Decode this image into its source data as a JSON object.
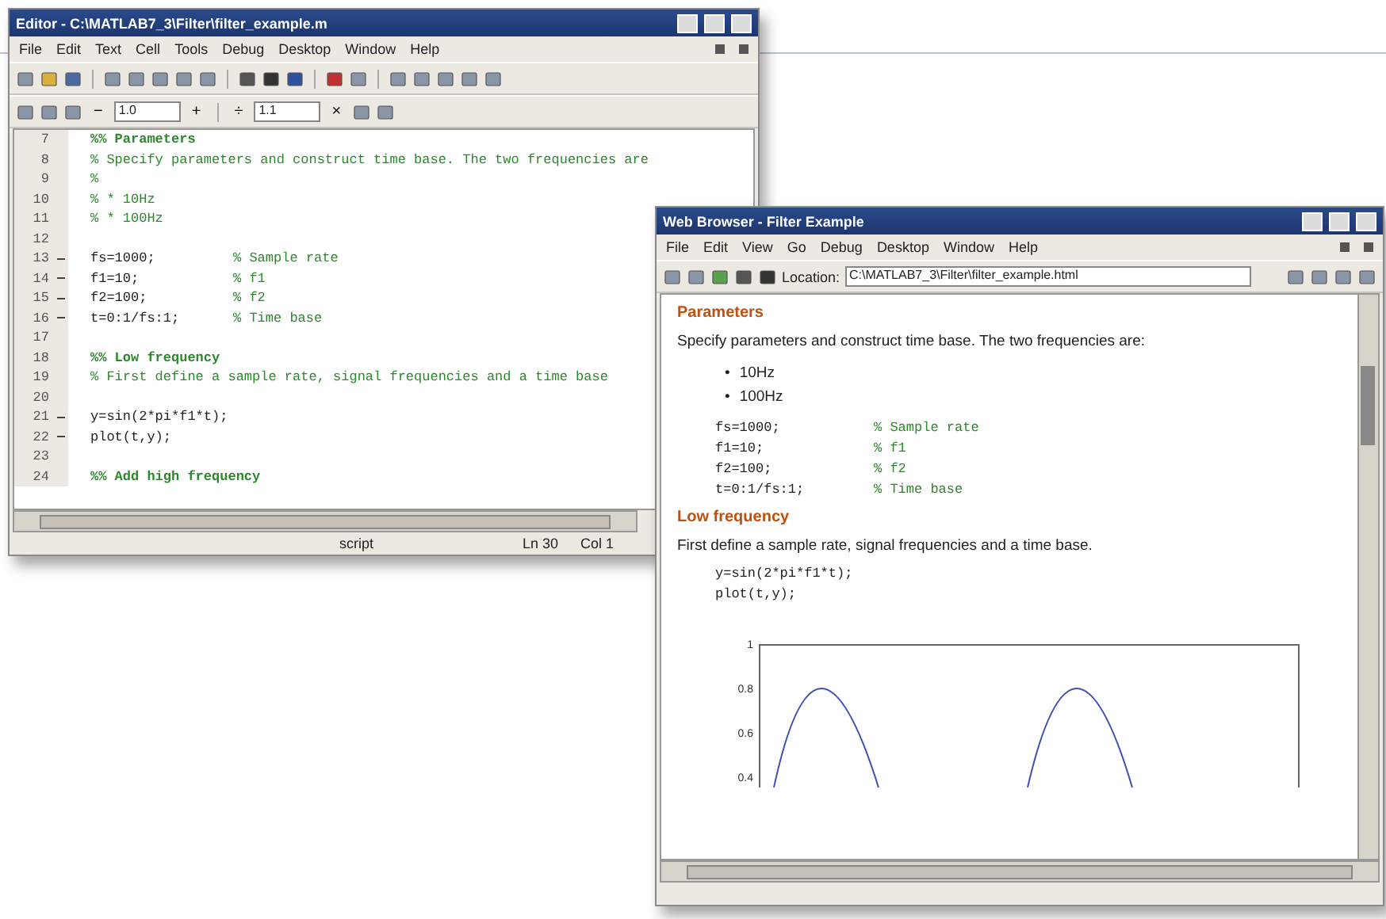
{
  "editor": {
    "title": "Editor - C:\\MATLAB7_3\\Filter\\filter_example.m",
    "menu": [
      "File",
      "Edit",
      "Text",
      "Cell",
      "Tools",
      "Debug",
      "Desktop",
      "Window",
      "Help"
    ],
    "cell_toolbar": {
      "minus": "−",
      "first_value": "1.0",
      "plus": "+",
      "divide": "÷",
      "second_value": "1.1",
      "times": "×"
    },
    "lines": [
      {
        "number": "7",
        "executable": false,
        "comment": "%% Parameters",
        "kind": "cell_title"
      },
      {
        "number": "8",
        "executable": false,
        "comment": "% Specify parameters and construct time base. The two frequencies are",
        "kind": "comment"
      },
      {
        "number": "9",
        "executable": false,
        "comment": "%",
        "kind": "comment"
      },
      {
        "number": "10",
        "executable": false,
        "comment": "% * 10Hz",
        "kind": "comment"
      },
      {
        "number": "11",
        "executable": false,
        "comment": "% * 100Hz",
        "kind": "comment"
      },
      {
        "number": "12",
        "executable": false,
        "kind": "blank"
      },
      {
        "number": "13",
        "executable": true,
        "code": "fs=1000;",
        "comment": "% Sample rate",
        "kind": "code"
      },
      {
        "number": "14",
        "executable": true,
        "code": "f1=10;",
        "comment": "% f1",
        "kind": "code"
      },
      {
        "number": "15",
        "executable": true,
        "code": "f2=100;",
        "comment": "% f2",
        "kind": "code"
      },
      {
        "number": "16",
        "executable": true,
        "code": "t=0:1/fs:1;",
        "comment": "% Time base",
        "kind": "code"
      },
      {
        "number": "17",
        "executable": false,
        "kind": "blank"
      },
      {
        "number": "18",
        "executable": false,
        "comment": "%% Low frequency",
        "kind": "cell_title"
      },
      {
        "number": "19",
        "executable": false,
        "comment": "% First define a sample rate, signal frequencies and a time base",
        "kind": "comment"
      },
      {
        "number": "20",
        "executable": false,
        "kind": "blank"
      },
      {
        "number": "21",
        "executable": true,
        "code": "y=sin(2*pi*f1*t);",
        "kind": "code"
      },
      {
        "number": "22",
        "executable": true,
        "code": "plot(t,y);",
        "kind": "code"
      },
      {
        "number": "23",
        "executable": false,
        "kind": "blank"
      },
      {
        "number": "24",
        "executable": false,
        "comment": "%% Add high frequency",
        "kind": "cell_title"
      }
    ],
    "status_bar": {
      "mode": "script",
      "line": "Ln 30",
      "column": "Col 1"
    }
  },
  "browser": {
    "title": "Web Browser - Filter Example",
    "menu": [
      "File",
      "Edit",
      "View",
      "Go",
      "Debug",
      "Desktop",
      "Window",
      "Help"
    ],
    "location_label": "Location:",
    "location": "C:\\MATLAB7_3\\Filter\\filter_example.html",
    "content": [
      {
        "kind": "heading",
        "text": "Parameters"
      },
      {
        "kind": "paragraph",
        "text": "Specify parameters and construct time base. The two frequencies are:"
      },
      {
        "kind": "bullets",
        "marker": "•",
        "items": [
          "10Hz",
          "100Hz"
        ]
      },
      {
        "kind": "code",
        "lines": [
          {
            "code": "fs=1000;",
            "comment": "% Sample rate"
          },
          {
            "code": "f1=10;",
            "comment": "% f1"
          },
          {
            "code": "f2=100;",
            "comment": "% f2"
          },
          {
            "code": "t=0:1/fs:1;",
            "comment": "% Time base"
          }
        ]
      },
      {
        "kind": "heading",
        "text": "Low frequency"
      },
      {
        "kind": "paragraph",
        "text": "First define a sample rate, signal frequencies and a time base."
      },
      {
        "kind": "code",
        "lines": [
          {
            "code": "y=sin(2*pi*f1*t);"
          },
          {
            "code": "plot(t,y);"
          }
        ]
      },
      {
        "kind": "plot",
        "y_ticks": [
          "1",
          "0.8",
          "0.6",
          "0.4"
        ]
      }
    ]
  }
}
